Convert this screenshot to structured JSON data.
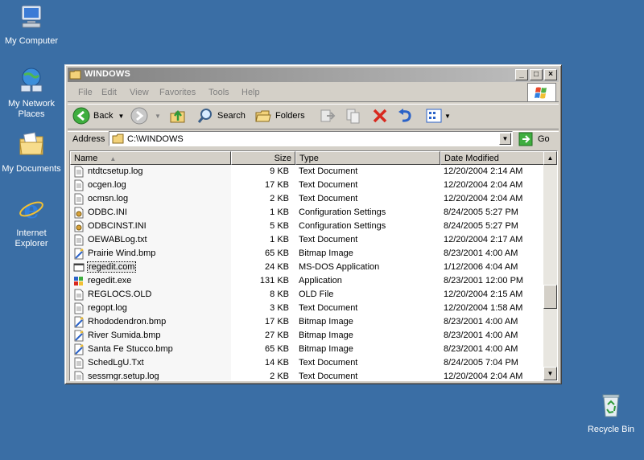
{
  "desktop": {
    "icons": [
      {
        "label": "My Computer"
      },
      {
        "label": "My Network Places"
      },
      {
        "label": "My Documents"
      },
      {
        "label": "Internet Explorer"
      },
      {
        "label": "Recycle Bin"
      }
    ]
  },
  "window": {
    "title": "WINDOWS",
    "controls": {
      "minimize": "_",
      "maximize": "□",
      "close": "×"
    },
    "menu": [
      "File",
      "Edit",
      "View",
      "Favorites",
      "Tools",
      "Help"
    ],
    "toolbar": {
      "back": "Back",
      "search": "Search",
      "folders": "Folders"
    },
    "address": {
      "label": "Address",
      "value": "C:\\WINDOWS",
      "go": "Go"
    },
    "columns": {
      "name": "Name",
      "size": "Size",
      "type": "Type",
      "date": "Date Modified"
    },
    "files": [
      {
        "name": "ntdtcsetup.log",
        "size": "9 KB",
        "type": "Text Document",
        "date": "12/20/2004 2:14 AM",
        "icon": "text-file-icon"
      },
      {
        "name": "ocgen.log",
        "size": "17 KB",
        "type": "Text Document",
        "date": "12/20/2004 2:04 AM",
        "icon": "text-file-icon"
      },
      {
        "name": "ocmsn.log",
        "size": "2 KB",
        "type": "Text Document",
        "date": "12/20/2004 2:04 AM",
        "icon": "text-file-icon"
      },
      {
        "name": "ODBC.INI",
        "size": "1 KB",
        "type": "Configuration Settings",
        "date": "8/24/2005 5:27 PM",
        "icon": "config-file-icon"
      },
      {
        "name": "ODBCINST.INI",
        "size": "5 KB",
        "type": "Configuration Settings",
        "date": "8/24/2005 5:27 PM",
        "icon": "config-file-icon"
      },
      {
        "name": "OEWABLog.txt",
        "size": "1 KB",
        "type": "Text Document",
        "date": "12/20/2004 2:17 AM",
        "icon": "text-file-icon"
      },
      {
        "name": "Prairie Wind.bmp",
        "size": "65 KB",
        "type": "Bitmap Image",
        "date": "8/23/2001 4:00 AM",
        "icon": "bitmap-file-icon"
      },
      {
        "name": "regedit.com",
        "size": "24 KB",
        "type": "MS-DOS Application",
        "date": "1/12/2006 4:04 AM",
        "icon": "dos-app-icon"
      },
      {
        "name": "regedit.exe",
        "size": "131 KB",
        "type": "Application",
        "date": "8/23/2001 12:00 PM",
        "icon": "regedit-icon"
      },
      {
        "name": "REGLOCS.OLD",
        "size": "8 KB",
        "type": "OLD File",
        "date": "12/20/2004 2:15 AM",
        "icon": "generic-file-icon"
      },
      {
        "name": "regopt.log",
        "size": "3 KB",
        "type": "Text Document",
        "date": "12/20/2004 1:58 AM",
        "icon": "text-file-icon"
      },
      {
        "name": "Rhododendron.bmp",
        "size": "17 KB",
        "type": "Bitmap Image",
        "date": "8/23/2001 4:00 AM",
        "icon": "bitmap-file-icon"
      },
      {
        "name": "River Sumida.bmp",
        "size": "27 KB",
        "type": "Bitmap Image",
        "date": "8/23/2001 4:00 AM",
        "icon": "bitmap-file-icon"
      },
      {
        "name": "Santa Fe Stucco.bmp",
        "size": "65 KB",
        "type": "Bitmap Image",
        "date": "8/23/2001 4:00 AM",
        "icon": "bitmap-file-icon"
      },
      {
        "name": "SchedLgU.Txt",
        "size": "14 KB",
        "type": "Text Document",
        "date": "8/24/2005 7:04 PM",
        "icon": "text-file-icon"
      },
      {
        "name": "sessmgr.setup.log",
        "size": "2 KB",
        "type": "Text Document",
        "date": "12/20/2004 2:04 AM",
        "icon": "text-file-icon"
      }
    ],
    "selected_file": "regedit.com"
  }
}
